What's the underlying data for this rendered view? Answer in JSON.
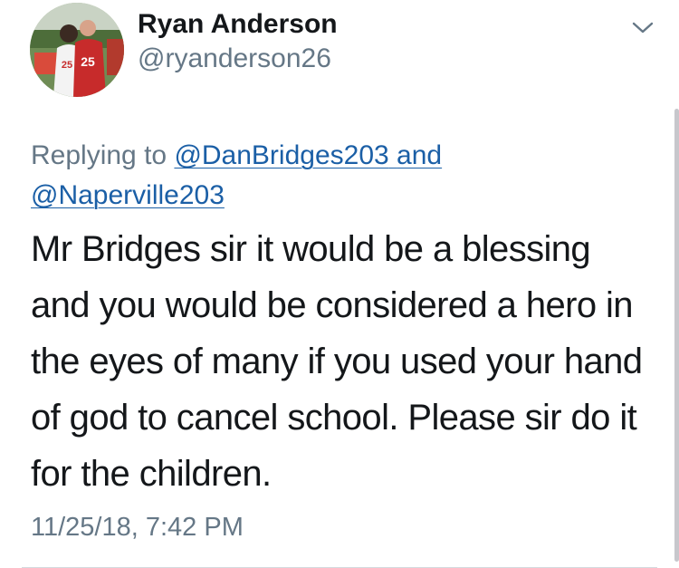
{
  "tweet": {
    "display_name": "Ryan Anderson",
    "handle": "@ryanderson26",
    "avatar_icon": "profile-photo",
    "menu_icon": "chevron-down-icon",
    "replying_prefix": "Replying to",
    "reply_to_1": "@DanBridges203",
    "reply_conjunction": "and",
    "reply_to_2": "@Naperville203",
    "text": "Mr Bridges sir it would be a blessing and you would be considered a hero in the eyes of many if you used your hand of god to cancel school. Please sir do it for the children.",
    "timestamp": "11/25/18, 7:42 PM"
  },
  "colors": {
    "text": "#14171a",
    "secondary": "#657786",
    "link": "#1b5fa6",
    "divider": "#d4d9dd"
  }
}
